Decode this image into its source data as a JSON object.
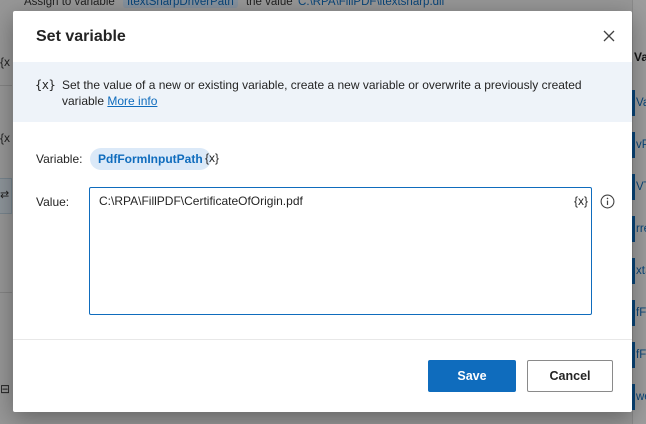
{
  "background": {
    "top_line": {
      "prefix": "Assign to variable",
      "variable": "ItextSharpDriverPath",
      "middle": "the value",
      "value": "'C:\\RPA\\FillPDF\\itextsharp.dll'"
    },
    "left_glyphs": [
      "{x",
      "{x",
      "⇄",
      "⊟"
    ],
    "right_header": "Va",
    "right_items": [
      "Vau",
      "vPa",
      "VT",
      "rre",
      "xtS",
      "fFc",
      "fFc",
      "we"
    ]
  },
  "dialog": {
    "title": "Set variable",
    "close_icon": "close-icon",
    "info": {
      "icon": "{x}",
      "text": "Set the value of a new or existing variable, create a new variable or overwrite a previously created variable",
      "link": "More info"
    },
    "variable": {
      "label": "Variable:",
      "name": "PdfFormInputPath",
      "icon": "{x}"
    },
    "value": {
      "label": "Value:",
      "text": "C:\\RPA\\FillPDF\\CertificateOfOrigin.pdf",
      "icon": "{x}"
    },
    "buttons": {
      "save": "Save",
      "cancel": "Cancel"
    }
  },
  "colors": {
    "accent": "#0f6cbd",
    "banner": "#eef3f9",
    "chip": "#dbe9f8"
  }
}
